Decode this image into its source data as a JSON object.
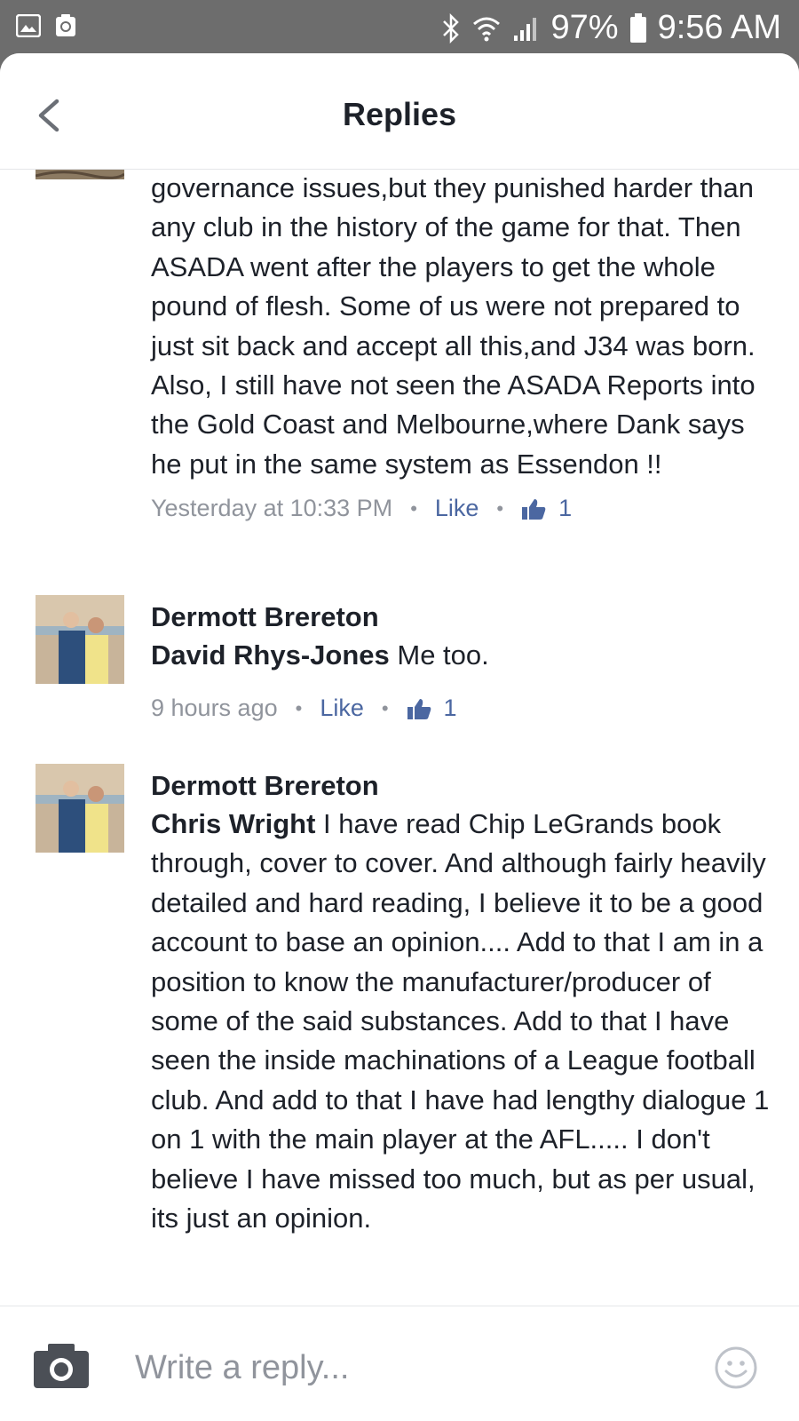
{
  "status_bar": {
    "battery": "97%",
    "time": "9:56 AM",
    "icons": [
      "gallery-icon",
      "recycle-icon",
      "bluetooth-icon",
      "wifi-icon",
      "signal-icon",
      "battery-icon"
    ]
  },
  "header": {
    "title": "Replies",
    "back_icon": "chevron-left-icon"
  },
  "comments": [
    {
      "text": "governance issues,but they punished harder than any club in the history of the game for that. Then ASADA went after the players to get the whole pound of flesh. Some of us were not prepared to just sit back and accept all this,and J34 was born. Also, I still have not seen the ASADA Reports into the Gold Coast and Melbourne,where Dank says he put in the same system as Essendon !!",
      "timestamp": "Yesterday at 10:33 PM",
      "like_label": "Like",
      "likes": "1"
    },
    {
      "author": "Dermott Brereton",
      "mention": "David Rhys-Jones",
      "text": " Me too.",
      "timestamp": "9 hours ago",
      "like_label": "Like",
      "likes": "1"
    },
    {
      "author": "Dermott Brereton",
      "mention": "Chris Wright",
      "text": " I have read Chip LeGrands book through, cover to cover. And although fairly heavily detailed and hard reading, I believe it to be a good account to base an opinion.... Add to that I am in a position to know the manufacturer/producer of some of the said substances. Add to that I have seen the inside machinations of a League football club. And add to that I have had lengthy dialogue 1 on 1 with the main player at the AFL..... I don't believe I have missed too much, but as per usual, its just an opinion."
    }
  ],
  "footer": {
    "placeholder": "Write a reply...",
    "camera_icon": "camera-icon",
    "emoji_icon": "smiley-icon"
  },
  "colors": {
    "status_bar": "#6d6d6d",
    "link": "#4b67a1",
    "meta": "#90949c",
    "text": "#1d2129"
  }
}
